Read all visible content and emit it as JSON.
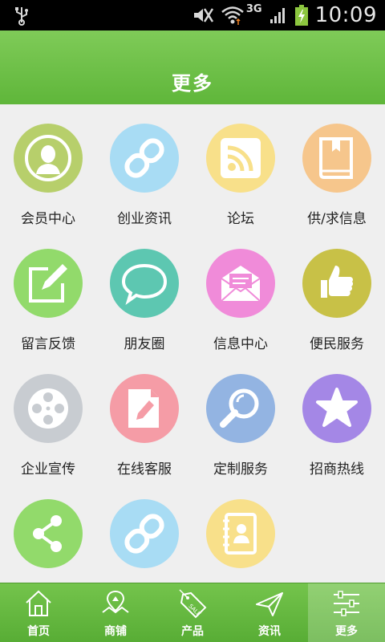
{
  "status_bar": {
    "time": "10:09",
    "network": "3G",
    "battery_color": "#8cc63f"
  },
  "header": {
    "title": "更多"
  },
  "grid": [
    {
      "label": "会员中心",
      "icon": "member-icon",
      "color": "#b7cf6b"
    },
    {
      "label": "创业资讯",
      "icon": "link-icon",
      "color": "#a8dcf4"
    },
    {
      "label": "论坛",
      "icon": "rss-icon",
      "color": "#f8e08a"
    },
    {
      "label": "供/求信息",
      "icon": "book-icon",
      "color": "#f6c68c"
    },
    {
      "label": "留言反馈",
      "icon": "edit-icon",
      "color": "#92da6b"
    },
    {
      "label": "朋友圈",
      "icon": "chat-icon",
      "color": "#5dc7b1"
    },
    {
      "label": "信息中心",
      "icon": "mail-icon",
      "color": "#f08bd9"
    },
    {
      "label": "便民服务",
      "icon": "thumbs-up-icon",
      "color": "#c8c147"
    },
    {
      "label": "企业宣传",
      "icon": "film-reel-icon",
      "color": "#c8ccd1"
    },
    {
      "label": "在线客服",
      "icon": "document-edit-icon",
      "color": "#f59ca6"
    },
    {
      "label": "定制服务",
      "icon": "magnifier-icon",
      "color": "#93b4e2"
    },
    {
      "label": "招商热线",
      "icon": "star-icon",
      "color": "#a487e6"
    },
    {
      "label": "",
      "icon": "share-icon",
      "color": "#92da6b"
    },
    {
      "label": "",
      "icon": "link-icon",
      "color": "#a8dcf4"
    },
    {
      "label": "",
      "icon": "contacts-icon",
      "color": "#f8e08a"
    }
  ],
  "tabs": [
    {
      "label": "首页",
      "icon": "home-icon",
      "active": false
    },
    {
      "label": "商铺",
      "icon": "map-icon",
      "active": false
    },
    {
      "label": "产品",
      "icon": "sale-tag-icon",
      "active": false
    },
    {
      "label": "资讯",
      "icon": "send-icon",
      "active": false
    },
    {
      "label": "更多",
      "icon": "settings-sliders-icon",
      "active": true
    }
  ]
}
